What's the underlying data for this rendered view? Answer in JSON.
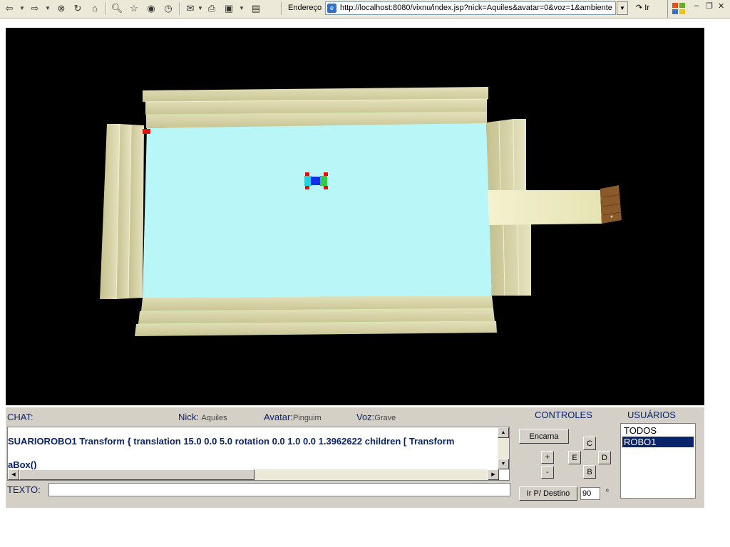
{
  "browser": {
    "address_label": "Endereço",
    "url": "http://localhost:8080/vixnu/index.jsp?nick=Aquiles&avatar=0&voz=1&ambiente",
    "go_label": "Ir"
  },
  "panel": {
    "chat_label": "CHAT:",
    "nick_label": "Nick:",
    "nick_value": "Aquiles",
    "avatar_label": "Avatar:",
    "avatar_value": "Pinguim",
    "voz_label": "Voz:",
    "voz_value": "Grave",
    "controls_label": "CONTROLES",
    "users_label": "USUÁRIOS",
    "chat_lines": [
      "SUARIOROBO1 Transform { translation 15.0 0.0 5.0 rotation 0.0 1.0 0.0 1.3962622 children [ Transform",
      "aBox()"
    ],
    "texto_label": "TEXTO:",
    "texto_value": "",
    "encarna_label": "Encarna",
    "plus_label": "+",
    "minus_label": "-",
    "dir_c": "C",
    "dir_e": "E",
    "dir_d": "D",
    "dir_b": "B",
    "destino_label": "Ir P/ Destino",
    "angle_value": "90",
    "degree_symbol": "º",
    "users": [
      "TODOS",
      "ROBO1"
    ],
    "selected_user": "ROBO1"
  },
  "colors": {
    "viewport_bg": "#000000",
    "floor": "#b9f6f8",
    "wall": "#dedbb0",
    "wall_shade": "#c9c596",
    "panel_bg": "#d4d0c8",
    "label_blue": "#0a246a"
  }
}
